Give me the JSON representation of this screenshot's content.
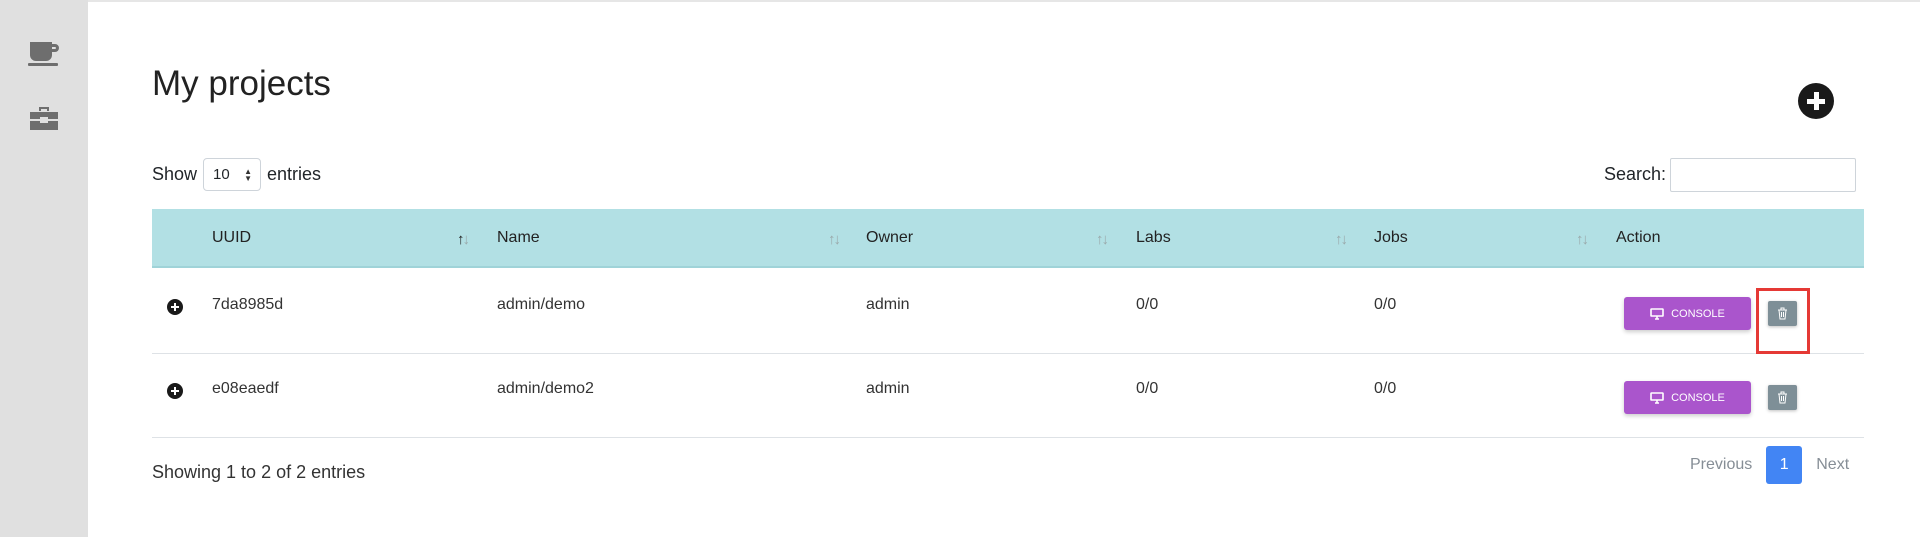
{
  "sidebar": {
    "items": [
      {
        "icon": "coffee-cup-icon"
      },
      {
        "icon": "toolbox-icon"
      }
    ]
  },
  "page": {
    "title": "My projects",
    "add_icon": "plus-circle-icon"
  },
  "length_menu": {
    "show_label": "Show",
    "selected": "10",
    "entries_label": "entries"
  },
  "search": {
    "label": "Search:",
    "value": ""
  },
  "table": {
    "columns": [
      "UUID",
      "Name",
      "Owner",
      "Labs",
      "Jobs",
      "Action"
    ],
    "sorted_column": "UUID",
    "sort_direction": "ascending",
    "rows": [
      {
        "uuid": "7da8985d",
        "name": "admin/demo",
        "owner": "admin",
        "labs": "0/0",
        "jobs": "0/0",
        "console_label": "CONSOLE"
      },
      {
        "uuid": "e08eaedf",
        "name": "admin/demo2",
        "owner": "admin",
        "labs": "0/0",
        "jobs": "0/0",
        "console_label": "CONSOLE"
      }
    ]
  },
  "footer": {
    "info": "Showing 1 to 2 of 2 entries",
    "previous": "Previous",
    "current_page": "1",
    "next": "Next"
  },
  "colors": {
    "header_bg": "#b2e0e4",
    "console_button": "#aa55cc",
    "delete_button": "#7e8f97",
    "active_page": "#4285f4",
    "highlight": "#e53935"
  }
}
